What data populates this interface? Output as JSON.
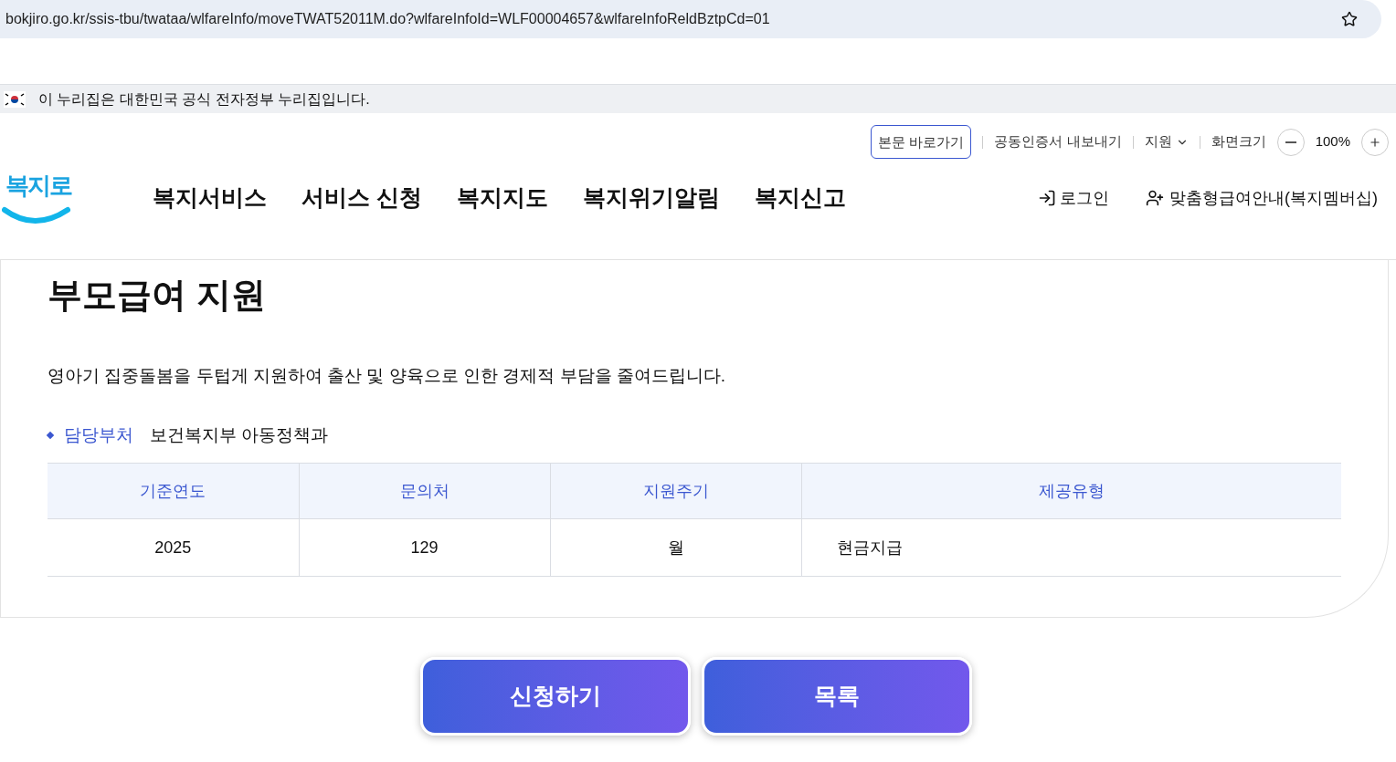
{
  "browser": {
    "url": "bokjiro.go.kr/ssis-tbu/twataa/wlfareInfo/moveTWAT52011M.do?wlfareInfoId=WLF00004657&wlfareInfoReldBztpCd=01"
  },
  "gov_banner": {
    "text": "이 누리집은 대한민국 공식 전자정부 누리집입니다."
  },
  "utility": {
    "skip_link": "본문 바로가기",
    "cert_export": "공동인증서 내보내기",
    "support": "지원",
    "zoom_label": "화면크기",
    "zoom_value": "100%"
  },
  "logo": {
    "text": "복지로"
  },
  "nav": [
    {
      "label": "복지서비스"
    },
    {
      "label": "서비스 신청"
    },
    {
      "label": "복지지도"
    },
    {
      "label": "복지위기알림"
    },
    {
      "label": "복지신고"
    }
  ],
  "account": {
    "login": "로그인",
    "membership": "맞춤형급여안내(복지멤버십)"
  },
  "page": {
    "title": "부모급여 지원",
    "description": "영아기 집중돌봄을 두텁게 지원하여 출산 및 양육으로 인한 경제적 부담을 줄여드립니다.",
    "dept_label": "담당부처",
    "dept_value": "보건복지부 아동정책과"
  },
  "table": {
    "columns": [
      "기준연도",
      "문의처",
      "지원주기",
      "제공유형"
    ],
    "rows": [
      {
        "cells": [
          "2025",
          "129",
          "월",
          "현금지급"
        ]
      }
    ]
  },
  "buttons": [
    "신청하기",
    "목록"
  ]
}
